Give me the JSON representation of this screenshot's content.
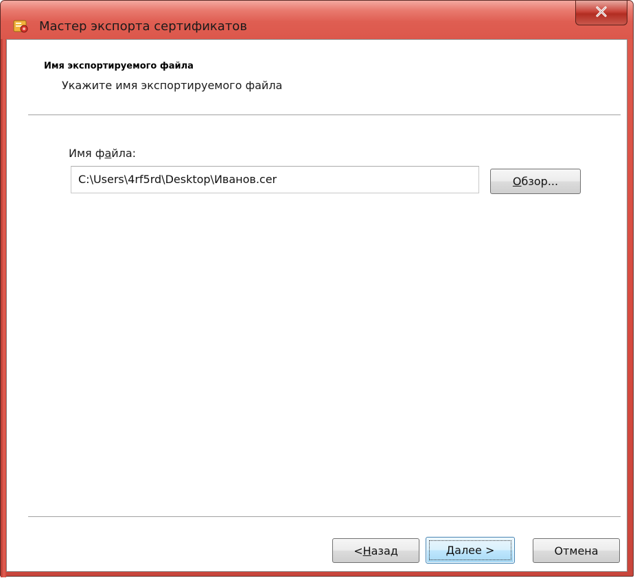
{
  "window": {
    "title": "Мастер экспорта сертификатов",
    "close_label": "x",
    "accent_color": "#dc574b"
  },
  "header": {
    "title": "Имя экспортируемого файла",
    "subtitle": "Укажите имя экспортируемого файла"
  },
  "file": {
    "label_prefix": "Имя ф",
    "label_accel": "а",
    "label_suffix": "йла:",
    "value": "C:\\Users\\4rf5rd\\Desktop\\Иванов.cer"
  },
  "buttons": {
    "browse_accel": "О",
    "browse_rest": "бзор...",
    "back_prefix": "< ",
    "back_accel": "Н",
    "back_rest": "азад",
    "next_accel": "Д",
    "next_rest": "алее >",
    "cancel_label": "Отмена"
  },
  "icons": {
    "app": "certificate-wizard-icon",
    "close": "close-icon"
  }
}
